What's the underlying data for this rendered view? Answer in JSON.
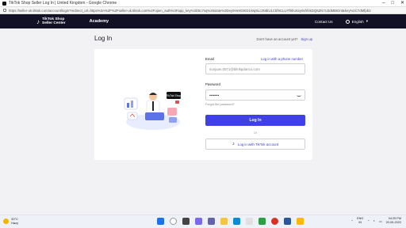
{
  "browser": {
    "window_title": "TikTok Shop Seller Log In | United Kingdom - Google Chrome",
    "url": "https://seller-uk.tiktok.com/account/login?redirect_url=https%3A%2F%2Fseller-uk.tiktok.com%2Fopen_auth%3Fapp_key%3D5c7sq%26state%3Dey9HeW3KD1Wq9Lc3NIbU1Cbf9CLUYf9hU6sy9xhf4kDQ6ZN7U3dMBIDnt&key%2C7dMfpb3"
  },
  "navbar": {
    "logo_line1": "TikTok Shop",
    "logo_line2": "Seller Center",
    "academy": "Academy",
    "contact": "Contact Us",
    "language": "English"
  },
  "page": {
    "title": "Log In",
    "no_account": "Don't have an account yet?",
    "sign_up": "Sign up"
  },
  "form": {
    "email_label": "Email",
    "phone_link": "Log in with a phone number",
    "email_value": "sunjuan.0071@blinkpdanco.com",
    "password_label": "Password",
    "password_value": "••••••••",
    "forgot": "Forgot the password?",
    "login_button": "Log In",
    "or": "Or",
    "tiktok_button": "Log in with TikTok account"
  },
  "illustration": {
    "badge": "TikTok Shop"
  },
  "taskbar": {
    "temp": "33°C",
    "weather": "Hazy",
    "lang1": "ENG",
    "lang2": "IN",
    "time": "04:25 PM",
    "date": "20-05-2022"
  },
  "colors": {
    "accent": "#4040e8",
    "nav_bg": "#121224"
  }
}
